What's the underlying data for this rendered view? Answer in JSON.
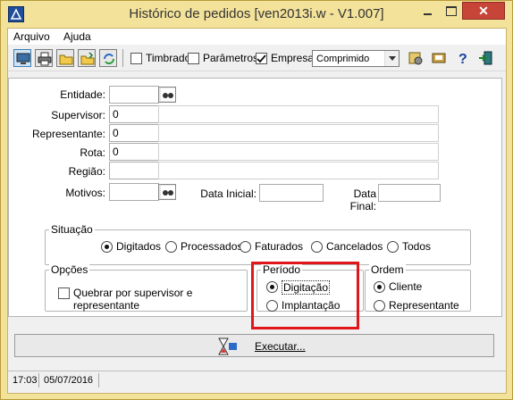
{
  "window": {
    "title": "Histórico de pedidos [ven2013i.w - V1.007]",
    "close_glyph": "✕"
  },
  "menu": [
    {
      "label": "Arquivo"
    },
    {
      "label": "Ajuda"
    }
  ],
  "toolbar": {
    "checkboxes": [
      {
        "label": "Timbrado",
        "checked": false
      },
      {
        "label": "Parâmetros",
        "checked": false
      },
      {
        "label": "Empresa",
        "checked": true
      }
    ],
    "format_select": "Comprimido"
  },
  "form": {
    "entidade": {
      "label": "Entidade:",
      "value": ""
    },
    "supervisor": {
      "label": "Supervisor:",
      "value": "0"
    },
    "representante": {
      "label": "Representante:",
      "value": "0"
    },
    "rota": {
      "label": "Rota:",
      "value": "0"
    },
    "regiao": {
      "label": "Região:",
      "value": ""
    },
    "motivos": {
      "label": "Motivos:",
      "value": ""
    },
    "data_inicial": {
      "label": "Data Inicial:",
      "value": ""
    },
    "data_final": {
      "label": "Data Final:",
      "value": ""
    }
  },
  "situacao": {
    "title": "Situação",
    "options": [
      {
        "label": "Digitados",
        "selected": true
      },
      {
        "label": "Processados",
        "selected": false
      },
      {
        "label": "Faturados",
        "selected": false
      },
      {
        "label": "Cancelados",
        "selected": false
      },
      {
        "label": "Todos",
        "selected": false
      }
    ]
  },
  "opcoes": {
    "title": "Opções",
    "quebrar_label": "Quebrar por supervisor e representante",
    "quebrar_checked": false
  },
  "periodo": {
    "title": "Período",
    "options": [
      {
        "label": "Digitação",
        "selected": true
      },
      {
        "label": "Implantação",
        "selected": false
      }
    ]
  },
  "ordem": {
    "title": "Ordem",
    "options": [
      {
        "label": "Cliente",
        "selected": true
      },
      {
        "label": "Representante",
        "selected": false
      }
    ]
  },
  "execute_label": "Executar...",
  "status": {
    "time": "17:03",
    "date": "05/07/2016"
  },
  "colors": {
    "highlight": "#e0161b",
    "title_bar": "#f3e29a",
    "close_button": "#c74538"
  }
}
